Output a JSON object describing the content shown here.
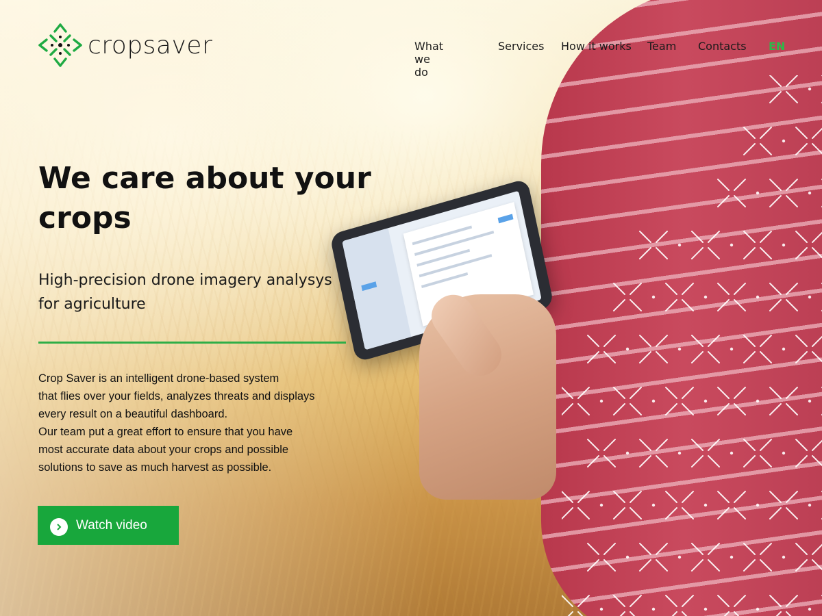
{
  "brand": {
    "name": "cropsaver",
    "accent": "#18a73c"
  },
  "nav": {
    "items": [
      "What we do",
      "Services",
      "How it works",
      "Team",
      "Contacts"
    ],
    "language": "EN"
  },
  "hero": {
    "headline": "We care about your crops",
    "subhead": "High-precision drone imagery analysys for agriculture",
    "description_1": "Crop Saver is an intelligent drone-based system\nthat flies over your fields, analyzes threats and displays\nevery result on a beautiful dashboard.",
    "description_2": "Our team put a great effort to ensure that you have\nmost accurate data about your crops and possible\nsolutions to save as much harvest as possible.",
    "cta_label": "Watch video",
    "cta_icon": "play-circle-icon"
  }
}
